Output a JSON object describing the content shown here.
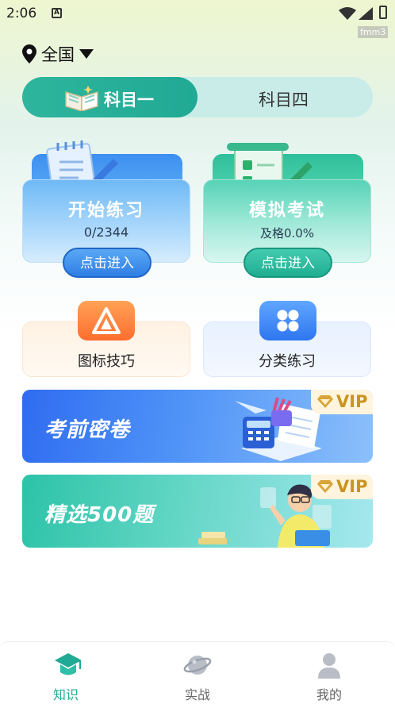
{
  "status_bar": {
    "time": "2:06",
    "notification_icon_letter": "A",
    "watermark": "fmm3"
  },
  "location": {
    "label": "全国"
  },
  "subject_tabs": [
    {
      "label": "科目一",
      "active": true
    },
    {
      "label": "科目四",
      "active": false
    }
  ],
  "cards": {
    "practice": {
      "title": "开始练习",
      "progress": "0/2344",
      "button": "点击进入"
    },
    "exam": {
      "title": "模拟考试",
      "pass_rate": "及格0.0%",
      "button": "点击进入"
    }
  },
  "tools": [
    {
      "label": "图标技巧",
      "icon": "triangle-logo-icon"
    },
    {
      "label": "分类练习",
      "icon": "four-petal-icon"
    }
  ],
  "banners": [
    {
      "title": "考前密卷",
      "badge": "VIP"
    },
    {
      "title": "精选500题",
      "badge": "VIP"
    }
  ],
  "bottom_nav": [
    {
      "label": "知识",
      "icon": "graduation-cap-icon",
      "active": true
    },
    {
      "label": "实战",
      "icon": "planet-icon",
      "active": false
    },
    {
      "label": "我的",
      "icon": "user-icon",
      "active": false
    }
  ],
  "colors": {
    "primary": "#20a994",
    "tab_bg": "#c9ece8",
    "vip_gold": "#c99422",
    "nav_active": "#20a994",
    "nav_inactive": "#666666"
  }
}
